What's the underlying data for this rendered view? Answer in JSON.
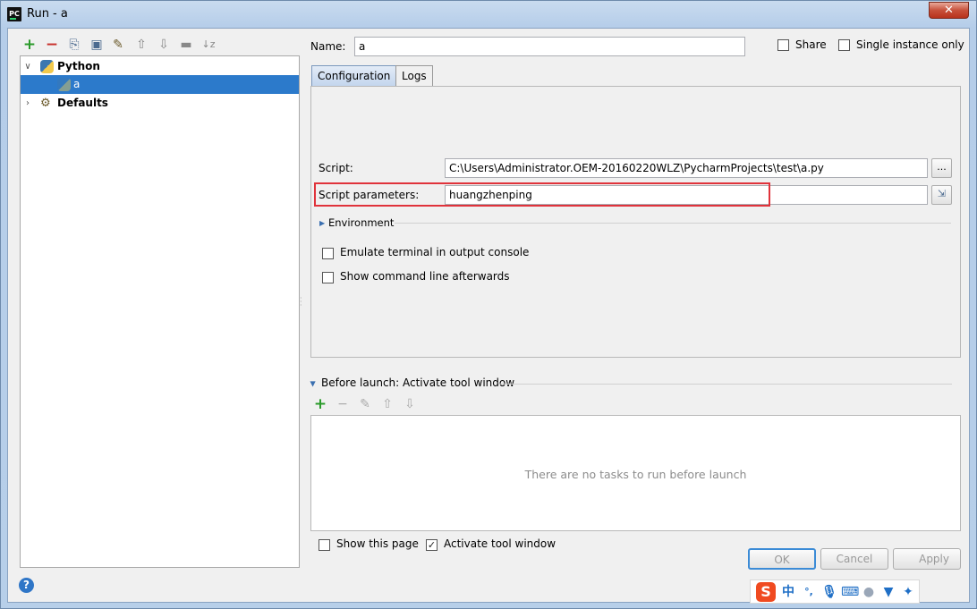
{
  "window": {
    "title": "Run - a",
    "app_icon_text": "PC",
    "close_glyph": "✕"
  },
  "left_toolbar": {
    "icons": [
      "add-icon",
      "remove-icon",
      "copy-icon",
      "save-icon",
      "edit-defaults-icon",
      "move-up-icon",
      "move-down-icon",
      "folder-icon",
      "sort-icon"
    ]
  },
  "tree": {
    "items": [
      {
        "label": "Python",
        "expanded": true
      },
      {
        "label": "a",
        "selected": true
      },
      {
        "label": "Defaults",
        "expanded": false
      }
    ]
  },
  "header": {
    "name_label": "Name:",
    "name_value": "a",
    "share_label": "Share",
    "single_instance_label": "Single instance only"
  },
  "tabs": [
    {
      "label": "Configuration",
      "active": true
    },
    {
      "label": "Logs",
      "active": false
    }
  ],
  "config": {
    "script_label": "Script:",
    "script_value": "C:\\Users\\Administrator.OEM-20160220WLZ\\PycharmProjects\\test\\a.py",
    "script_browse": "...",
    "params_label": "Script parameters:",
    "params_value": "huangzhenping",
    "environment_label": "Environment",
    "emulate_terminal_label": "Emulate terminal in output console",
    "show_cmdline_label": "Show command line afterwards"
  },
  "before_launch": {
    "title": "Before launch: Activate tool window",
    "empty_text": "There are no tasks to run before launch",
    "show_page_label": "Show this page",
    "activate_tool_window_label": "Activate tool window",
    "activate_checked": true
  },
  "buttons": {
    "ok": "OK",
    "cancel": "Cancel",
    "apply": "Apply"
  },
  "ime": {
    "logo": "S",
    "lang": "中",
    "punct": "°,"
  },
  "colors": {
    "selection": "#2c7acb",
    "highlight": "#e0333b",
    "accent": "#2f76c7"
  }
}
